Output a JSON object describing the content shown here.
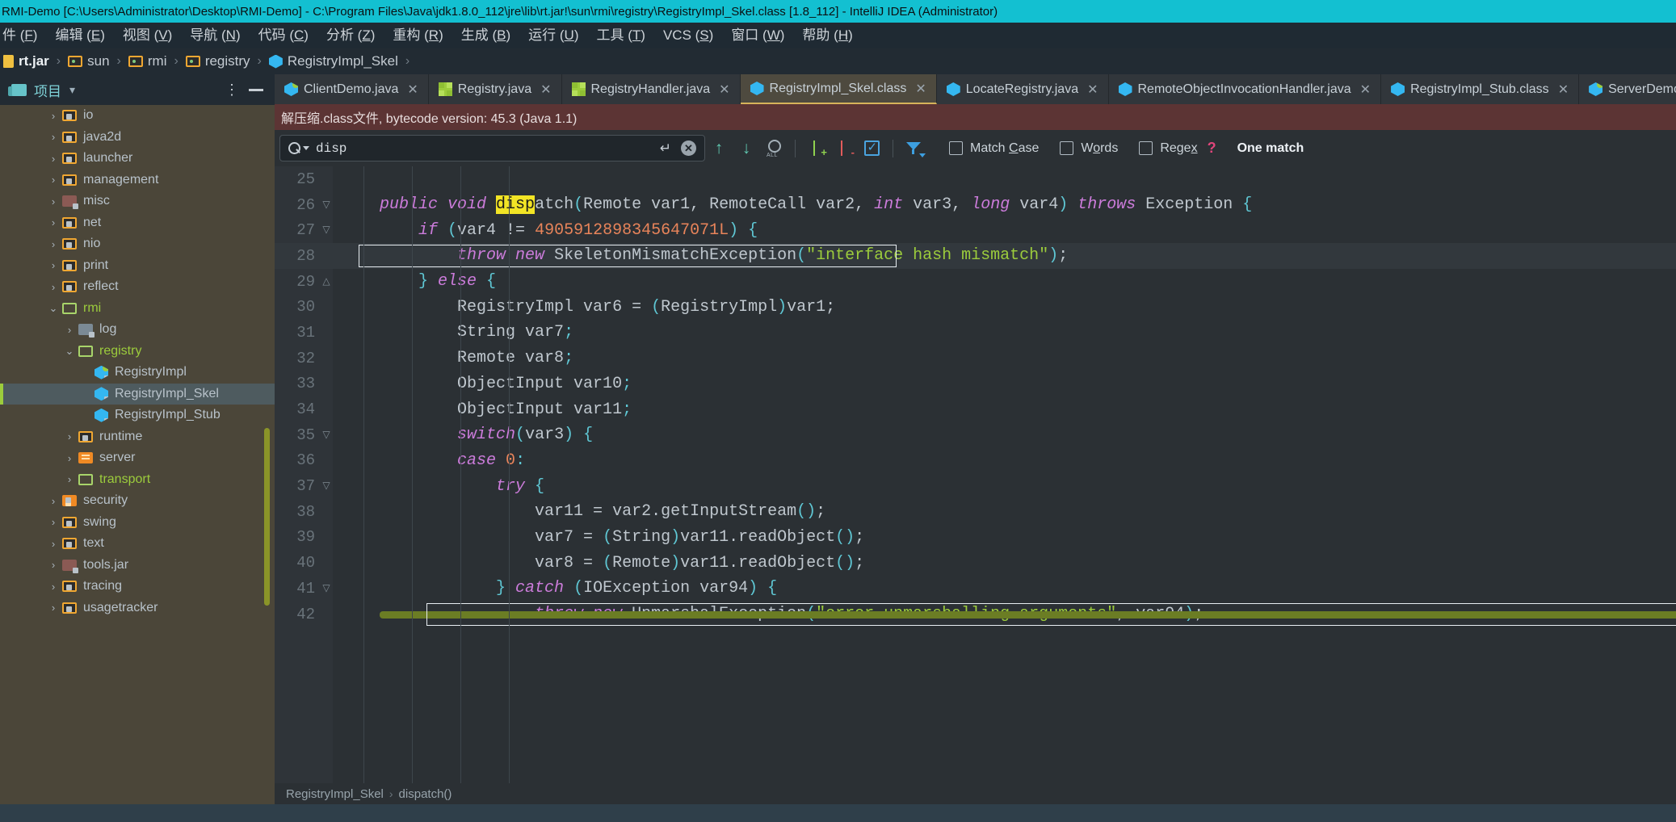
{
  "window": {
    "title": "RMI-Demo [C:\\Users\\Administrator\\Desktop\\RMI-Demo] - C:\\Program Files\\Java\\jdk1.8.0_112\\jre\\lib\\rt.jar!\\sun\\rmi\\registry\\RegistryImpl_Skel.class [1.8_112] - IntelliJ IDEA (Administrator)"
  },
  "menubar": {
    "items": [
      {
        "label": "件",
        "mnemonic": "F"
      },
      {
        "label": "编辑",
        "mnemonic": "E"
      },
      {
        "label": "视图",
        "mnemonic": "V"
      },
      {
        "label": "导航",
        "mnemonic": "N"
      },
      {
        "label": "代码",
        "mnemonic": "C"
      },
      {
        "label": "分析",
        "mnemonic": "Z"
      },
      {
        "label": "重构",
        "mnemonic": "R"
      },
      {
        "label": "生成",
        "mnemonic": "B"
      },
      {
        "label": "运行",
        "mnemonic": "U"
      },
      {
        "label": "工具",
        "mnemonic": "T"
      },
      {
        "label": "VCS",
        "mnemonic": "S"
      },
      {
        "label": "窗口",
        "mnemonic": "W"
      },
      {
        "label": "帮助",
        "mnemonic": "H"
      }
    ]
  },
  "breadcrumb": {
    "items": [
      {
        "label": "rt.jar",
        "icon": "jar-icon",
        "bold": true
      },
      {
        "label": "sun",
        "icon": "folder-icon",
        "bold": false
      },
      {
        "label": "rmi",
        "icon": "folder-icon",
        "bold": false
      },
      {
        "label": "registry",
        "icon": "folder-icon",
        "bold": false
      },
      {
        "label": "RegistryImpl_Skel",
        "icon": "class-icon",
        "bold": false
      }
    ]
  },
  "sidebar": {
    "title": "项目",
    "tree": [
      {
        "label": "io",
        "indent": 2,
        "twist": "›",
        "icon": "folder-locked-icon",
        "green": false,
        "selected": false
      },
      {
        "label": "java2d",
        "indent": 2,
        "twist": "›",
        "icon": "folder-locked-icon",
        "green": false,
        "selected": false
      },
      {
        "label": "launcher",
        "indent": 2,
        "twist": "›",
        "icon": "folder-locked-icon",
        "green": false,
        "selected": false
      },
      {
        "label": "management",
        "indent": 2,
        "twist": "›",
        "icon": "folder-locked-icon",
        "green": false,
        "selected": false
      },
      {
        "label": "misc",
        "indent": 2,
        "twist": "›",
        "icon": "folder-dark-icon",
        "green": false,
        "selected": false
      },
      {
        "label": "net",
        "indent": 2,
        "twist": "›",
        "icon": "folder-locked-icon",
        "green": false,
        "selected": false
      },
      {
        "label": "nio",
        "indent": 2,
        "twist": "›",
        "icon": "folder-locked-icon",
        "green": false,
        "selected": false
      },
      {
        "label": "print",
        "indent": 2,
        "twist": "›",
        "icon": "folder-locked-icon",
        "green": false,
        "selected": false
      },
      {
        "label": "reflect",
        "indent": 2,
        "twist": "›",
        "icon": "folder-locked-icon",
        "green": false,
        "selected": false
      },
      {
        "label": "rmi",
        "indent": 2,
        "twist": "⌄",
        "icon": "folder-open-icon",
        "green": true,
        "selected": false
      },
      {
        "label": "log",
        "indent": 3,
        "twist": "›",
        "icon": "folder-grey-icon",
        "green": false,
        "selected": false
      },
      {
        "label": "registry",
        "indent": 3,
        "twist": "⌄",
        "icon": "folder-open-icon",
        "green": true,
        "selected": false
      },
      {
        "label": "RegistryImpl",
        "indent": 4,
        "twist": "",
        "icon": "class-green-icon",
        "green": false,
        "selected": false
      },
      {
        "label": "RegistryImpl_Skel",
        "indent": 4,
        "twist": "",
        "icon": "class-star-icon",
        "green": false,
        "selected": true
      },
      {
        "label": "RegistryImpl_Stub",
        "indent": 4,
        "twist": "",
        "icon": "class-star-icon",
        "green": false,
        "selected": false
      },
      {
        "label": "runtime",
        "indent": 3,
        "twist": "›",
        "icon": "folder-locked-icon",
        "green": false,
        "selected": false
      },
      {
        "label": "server",
        "indent": 3,
        "twist": "›",
        "icon": "folder-orange-icon",
        "green": false,
        "selected": false
      },
      {
        "label": "transport",
        "indent": 3,
        "twist": "›",
        "icon": "folder-open-icon",
        "green": true,
        "selected": false
      },
      {
        "label": "security",
        "indent": 2,
        "twist": "›",
        "icon": "folder-lockbig-icon",
        "green": false,
        "selected": false
      },
      {
        "label": "swing",
        "indent": 2,
        "twist": "›",
        "icon": "folder-locked-icon",
        "green": false,
        "selected": false
      },
      {
        "label": "text",
        "indent": 2,
        "twist": "›",
        "icon": "folder-locked-icon",
        "green": false,
        "selected": false
      },
      {
        "label": "tools.jar",
        "indent": 2,
        "twist": "›",
        "icon": "folder-dark-icon",
        "green": false,
        "selected": false
      },
      {
        "label": "tracing",
        "indent": 2,
        "twist": "›",
        "icon": "folder-locked-icon",
        "green": false,
        "selected": false
      },
      {
        "label": "usagetracker",
        "indent": 2,
        "twist": "›",
        "icon": "folder-locked-icon",
        "green": false,
        "selected": false
      }
    ]
  },
  "tabs": [
    {
      "label": "ClientDemo.java",
      "icon": "class-icon",
      "active": false,
      "closable": true
    },
    {
      "label": "Registry.java",
      "icon": "interface-icon",
      "active": false,
      "closable": true
    },
    {
      "label": "RegistryHandler.java",
      "icon": "interface-icon",
      "active": false,
      "closable": true
    },
    {
      "label": "RegistryImpl_Skel.class",
      "icon": "class-star-icon",
      "active": true,
      "closable": true
    },
    {
      "label": "LocateRegistry.java",
      "icon": "class-star-icon",
      "active": false,
      "closable": true
    },
    {
      "label": "RemoteObjectInvocationHandler.java",
      "icon": "class-star-icon",
      "active": false,
      "closable": true
    },
    {
      "label": "RegistryImpl_Stub.class",
      "icon": "class-star-icon",
      "active": false,
      "closable": true
    },
    {
      "label": "ServerDemo.java",
      "icon": "class-icon",
      "active": false,
      "closable": false
    }
  ],
  "banner": {
    "text": "解压缩.class文件, bytecode version: 45.3 (Java 1.1)"
  },
  "find": {
    "query": "disp",
    "enter_icon": "↵",
    "clear_icon": "✕",
    "prev_label": "↑",
    "next_label": "↓",
    "find_all_label": "ALL",
    "checkboxes": [
      {
        "label_pre": "Match ",
        "mnemonic": "C",
        "label_post": "ase",
        "checked": false
      },
      {
        "label_pre": "W",
        "mnemonic": "o",
        "label_post": "rds",
        "checked": false
      },
      {
        "label_pre": "Rege",
        "mnemonic": "x",
        "label_post": "",
        "checked": false
      }
    ],
    "help": "?",
    "match_count": "One match"
  },
  "editor": {
    "first_line": 25,
    "status_breadcrumb": [
      "RegistryImpl_Skel",
      "dispatch()"
    ],
    "lines": [
      {
        "n": 25,
        "fold": "",
        "highlight": false,
        "indent": 0,
        "tokens": []
      },
      {
        "n": 26,
        "fold": "▽",
        "highlight": false,
        "indent": 2,
        "tokens": [
          {
            "t": "public ",
            "c": "kw"
          },
          {
            "t": "void ",
            "c": "kw"
          },
          {
            "t": "disp",
            "c": "hl-search"
          },
          {
            "t": "atch",
            "c": "plain"
          },
          {
            "t": "(",
            "c": "paren"
          },
          {
            "t": "Remote var1, RemoteCall var2, ",
            "c": "plain"
          },
          {
            "t": "int ",
            "c": "kw"
          },
          {
            "t": "var3, ",
            "c": "plain"
          },
          {
            "t": "long ",
            "c": "kw"
          },
          {
            "t": "var4",
            "c": "plain"
          },
          {
            "t": ")",
            "c": "paren"
          },
          {
            "t": " ",
            "c": "plain"
          },
          {
            "t": "throws ",
            "c": "kw"
          },
          {
            "t": "Exception ",
            "c": "plain"
          },
          {
            "t": "{",
            "c": "paren"
          }
        ]
      },
      {
        "n": 27,
        "fold": "▽",
        "highlight": false,
        "indent": 4,
        "tokens": [
          {
            "t": "if ",
            "c": "kw"
          },
          {
            "t": "(",
            "c": "paren"
          },
          {
            "t": "var4 != ",
            "c": "plain"
          },
          {
            "t": "4905912898345647071L",
            "c": "num"
          },
          {
            "t": ")",
            "c": "paren"
          },
          {
            "t": " ",
            "c": "plain"
          },
          {
            "t": "{",
            "c": "paren"
          }
        ]
      },
      {
        "n": 28,
        "fold": "",
        "highlight": true,
        "indent": 6,
        "tokens": [
          {
            "t": "throw new ",
            "c": "kw"
          },
          {
            "t": "SkeletonMismatchException",
            "c": "plain"
          },
          {
            "t": "(",
            "c": "paren"
          },
          {
            "t": "\"interface hash mismatch\"",
            "c": "str"
          },
          {
            "t": ")",
            "c": "paren"
          },
          {
            "t": ";",
            "c": "plain"
          }
        ]
      },
      {
        "n": 29,
        "fold": "△",
        "highlight": false,
        "indent": 4,
        "tokens": [
          {
            "t": "} ",
            "c": "paren"
          },
          {
            "t": "else ",
            "c": "kw"
          },
          {
            "t": "{",
            "c": "paren"
          }
        ]
      },
      {
        "n": 30,
        "fold": "",
        "highlight": false,
        "indent": 6,
        "tokens": [
          {
            "t": "RegistryImpl var6 = ",
            "c": "plain"
          },
          {
            "t": "(",
            "c": "paren"
          },
          {
            "t": "RegistryImpl",
            "c": "plain"
          },
          {
            "t": ")",
            "c": "paren"
          },
          {
            "t": "var1;",
            "c": "plain"
          }
        ]
      },
      {
        "n": 31,
        "fold": "",
        "highlight": false,
        "indent": 6,
        "tokens": [
          {
            "t": "String var7",
            "c": "plain"
          },
          {
            "t": ";",
            "c": "paren"
          }
        ]
      },
      {
        "n": 32,
        "fold": "",
        "highlight": false,
        "indent": 6,
        "tokens": [
          {
            "t": "Remote var8",
            "c": "plain"
          },
          {
            "t": ";",
            "c": "paren"
          }
        ]
      },
      {
        "n": 33,
        "fold": "",
        "highlight": false,
        "indent": 6,
        "tokens": [
          {
            "t": "ObjectInput var10",
            "c": "plain"
          },
          {
            "t": ";",
            "c": "paren"
          }
        ]
      },
      {
        "n": 34,
        "fold": "",
        "highlight": false,
        "indent": 6,
        "tokens": [
          {
            "t": "ObjectInput var11",
            "c": "plain"
          },
          {
            "t": ";",
            "c": "paren"
          }
        ]
      },
      {
        "n": 35,
        "fold": "▽",
        "highlight": false,
        "indent": 6,
        "tokens": [
          {
            "t": "switch",
            "c": "kw"
          },
          {
            "t": "(",
            "c": "paren"
          },
          {
            "t": "var3",
            "c": "plain"
          },
          {
            "t": ")",
            "c": "paren"
          },
          {
            "t": " ",
            "c": "plain"
          },
          {
            "t": "{",
            "c": "paren"
          }
        ]
      },
      {
        "n": 36,
        "fold": "",
        "highlight": false,
        "indent": 6,
        "tokens": [
          {
            "t": "case ",
            "c": "kw"
          },
          {
            "t": "0",
            "c": "num"
          },
          {
            "t": ":",
            "c": "paren"
          }
        ]
      },
      {
        "n": 37,
        "fold": "▽",
        "highlight": false,
        "indent": 8,
        "tokens": [
          {
            "t": "try ",
            "c": "kw"
          },
          {
            "t": "{",
            "c": "paren"
          }
        ]
      },
      {
        "n": 38,
        "fold": "",
        "highlight": false,
        "indent": 10,
        "tokens": [
          {
            "t": "var11 = var2.getInputStream",
            "c": "plain"
          },
          {
            "t": "()",
            "c": "paren"
          },
          {
            "t": ";",
            "c": "plain"
          }
        ]
      },
      {
        "n": 39,
        "fold": "",
        "highlight": false,
        "indent": 10,
        "tokens": [
          {
            "t": "var7 = ",
            "c": "plain"
          },
          {
            "t": "(",
            "c": "paren"
          },
          {
            "t": "String",
            "c": "plain"
          },
          {
            "t": ")",
            "c": "paren"
          },
          {
            "t": "var11.readObject",
            "c": "plain"
          },
          {
            "t": "()",
            "c": "paren"
          },
          {
            "t": ";",
            "c": "plain"
          }
        ]
      },
      {
        "n": 40,
        "fold": "",
        "highlight": false,
        "indent": 10,
        "tokens": [
          {
            "t": "var8 = ",
            "c": "plain"
          },
          {
            "t": "(",
            "c": "paren"
          },
          {
            "t": "Remote",
            "c": "plain"
          },
          {
            "t": ")",
            "c": "paren"
          },
          {
            "t": "var11.readObject",
            "c": "plain"
          },
          {
            "t": "()",
            "c": "paren"
          },
          {
            "t": ";",
            "c": "plain"
          }
        ]
      },
      {
        "n": 41,
        "fold": "▽",
        "highlight": false,
        "indent": 8,
        "tokens": [
          {
            "t": "} ",
            "c": "paren"
          },
          {
            "t": "catch ",
            "c": "kw"
          },
          {
            "t": "(",
            "c": "paren"
          },
          {
            "t": "IOException var94",
            "c": "plain"
          },
          {
            "t": ")",
            "c": "paren"
          },
          {
            "t": " ",
            "c": "plain"
          },
          {
            "t": "{",
            "c": "paren"
          }
        ]
      },
      {
        "n": 42,
        "fold": "",
        "highlight": false,
        "indent": 10,
        "tokens": [
          {
            "t": "throw new ",
            "c": "kw"
          },
          {
            "t": "UnmarshalException",
            "c": "plain"
          },
          {
            "t": "(",
            "c": "paren"
          },
          {
            "t": "\"error unmarshalling arguments\"",
            "c": "str"
          },
          {
            "t": ", var94",
            "c": "plain"
          },
          {
            "t": ")",
            "c": "paren"
          },
          {
            "t": ";",
            "c": "plain"
          }
        ]
      }
    ]
  },
  "colors": {
    "titlebar": "#13c0d1",
    "banner": "#5c3434",
    "sidebar_bg": "#4b4639",
    "editor_bg": "#2b3034",
    "selection": "#4e5b5f",
    "accent_green": "#9ccc3c",
    "search_highlight": "#f2e425",
    "scrollbar": "#8a9428"
  }
}
